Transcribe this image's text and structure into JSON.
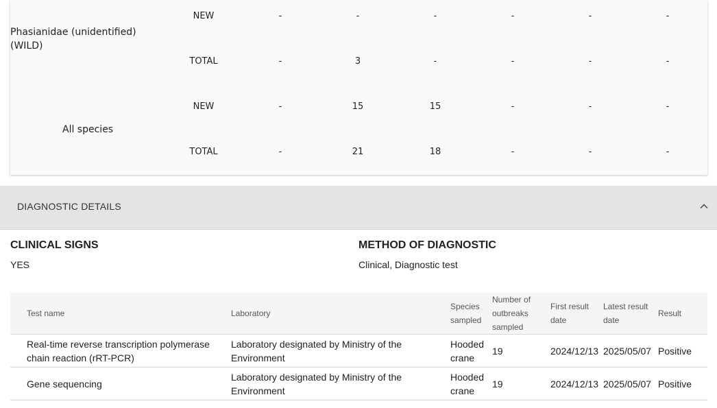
{
  "species_table": {
    "groups": [
      {
        "species": "Phasianidae (unidentified) (WILD)",
        "rows": [
          {
            "label": "NEW",
            "values": [
              "-",
              "-",
              "-",
              "-",
              "-",
              "-"
            ]
          },
          {
            "label": "TOTAL",
            "values": [
              "-",
              "3",
              "-",
              "-",
              "-",
              "-"
            ]
          }
        ]
      },
      {
        "species": "All species",
        "rows": [
          {
            "label": "NEW",
            "values": [
              "-",
              "15",
              "15",
              "-",
              "-",
              "-"
            ]
          },
          {
            "label": "TOTAL",
            "values": [
              "-",
              "21",
              "18",
              "-",
              "-",
              "-"
            ]
          }
        ]
      }
    ]
  },
  "diagnostic": {
    "section_title": "DIAGNOSTIC DETAILS",
    "collapse_icon": "chevron-up-icon",
    "clinical_signs_label": "CLINICAL SIGNS",
    "clinical_signs_value": "YES",
    "method_label": "METHOD OF DIAGNOSTIC",
    "method_value": "Clinical, Diagnostic test",
    "table": {
      "headers": [
        "Test name",
        "Laboratory",
        "Species sampled",
        "Number of outbreaks sampled",
        "First result date",
        "Latest result date",
        "Result"
      ],
      "rows": [
        [
          "Real-time reverse transcription polymerase chain reaction (rRT-PCR)",
          "Laboratory designated by Ministry of the Environment",
          "Hooded crane",
          "19",
          "2024/12/13",
          "2025/05/07",
          "Positive"
        ],
        [
          "Gene sequencing",
          "Laboratory designated by Ministry of the Environment",
          "Hooded crane",
          "19",
          "2024/12/13",
          "2025/05/07",
          "Positive"
        ]
      ]
    }
  }
}
